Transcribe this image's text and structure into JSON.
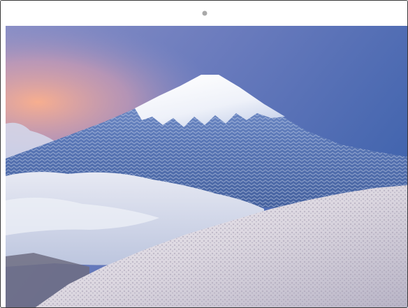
{
  "device": {
    "camera_icon": "camera-dot-icon"
  },
  "photo": {
    "subject": "snow-capped-mountain-photo",
    "colors": {
      "sky_top": "#4a6bb0",
      "sky_horizon": "#f2a98e",
      "snow": "#f4f6fb",
      "slope_blue": "#5e7fbd",
      "cloud": "#dfe3ef",
      "forest_snow": "#e9e4ea"
    }
  }
}
